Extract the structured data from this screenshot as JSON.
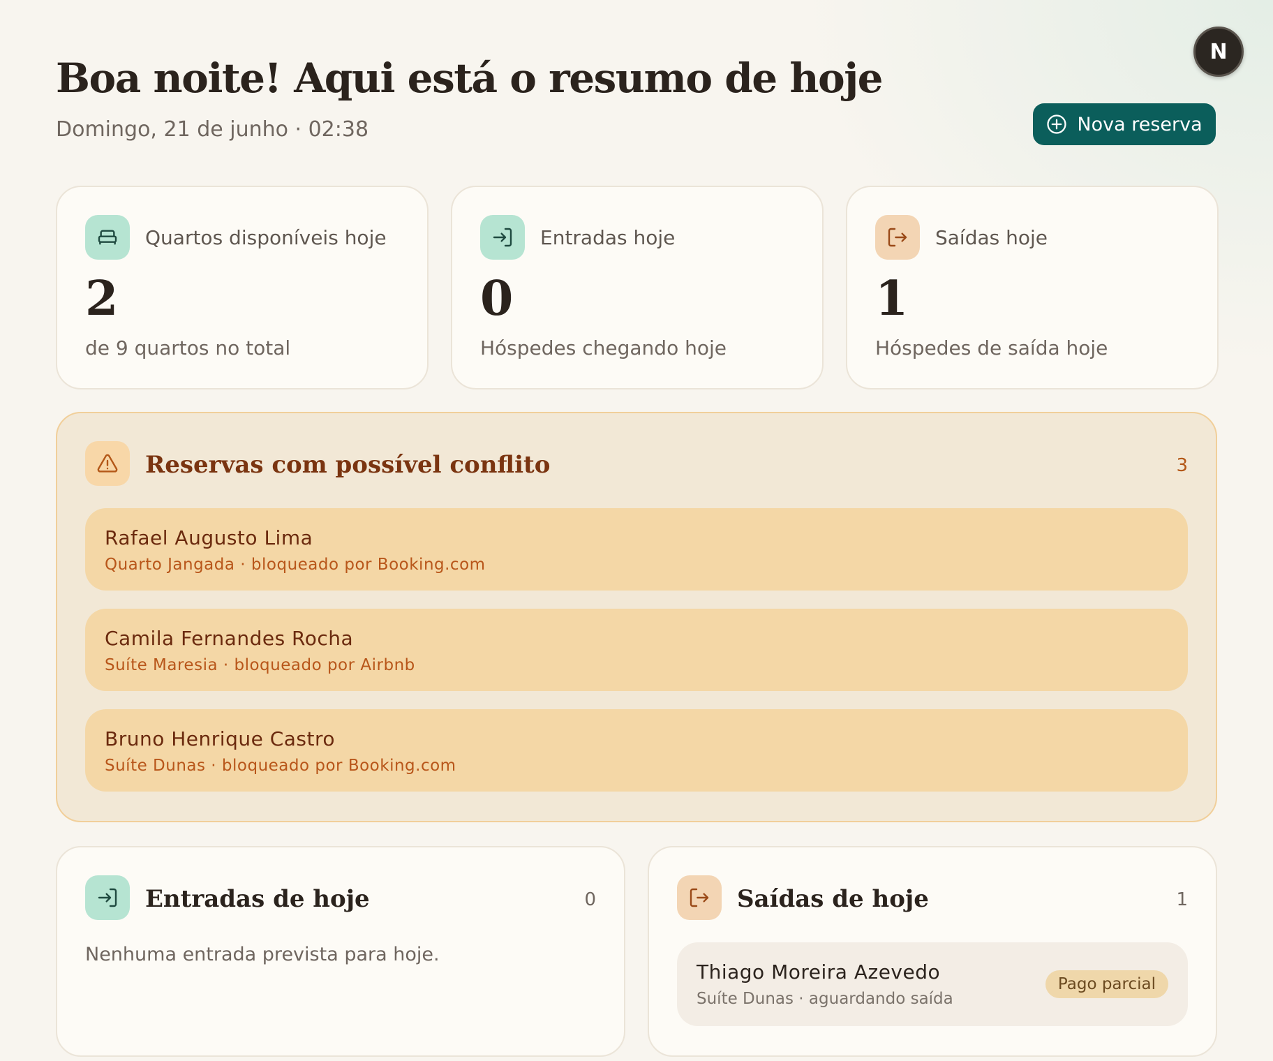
{
  "header": {
    "title": "Boa noite! Aqui está o resumo de hoje",
    "date": "Domingo, 21 de junho · 02:38",
    "avatar_initial": "N",
    "new_booking_label": "Nova reserva"
  },
  "stats": [
    {
      "label": "Quartos disponíveis hoje",
      "value": "2",
      "sub": "de 9 quartos no total",
      "icon": "bed-icon"
    },
    {
      "label": "Entradas hoje",
      "value": "0",
      "sub": "Hóspedes chegando hoje",
      "icon": "login-icon"
    },
    {
      "label": "Saídas hoje",
      "value": "1",
      "sub": "Hóspedes de saída hoje",
      "icon": "logout-icon"
    }
  ],
  "conflicts": {
    "title": "Reservas com possível conflito",
    "count": "3",
    "icon": "warning-icon",
    "items": [
      {
        "name": "Rafael Augusto Lima",
        "detail": "Quarto Jangada · bloqueado por Booking.com"
      },
      {
        "name": "Camila Fernandes Rocha",
        "detail": "Suíte Maresia · bloqueado por Airbnb"
      },
      {
        "name": "Bruno Henrique Castro",
        "detail": "Suíte Dunas · bloqueado por Booking.com"
      }
    ]
  },
  "arrivals": {
    "title": "Entradas de hoje",
    "count": "0",
    "empty": "Nenhuma entrada prevista para hoje."
  },
  "departures": {
    "title": "Saídas de hoje",
    "count": "1",
    "items": [
      {
        "name": "Thiago Moreira Azevedo",
        "detail": "Suíte Dunas · aguardando saída",
        "badge": "Pago parcial"
      }
    ]
  },
  "colors": {
    "accent": "#0b5e5b",
    "warning_bg": "#f4d7a6",
    "warning_text": "#b35717",
    "green_icon_bg": "#b6e4d2",
    "orange_icon_bg": "#f3d5b4"
  }
}
